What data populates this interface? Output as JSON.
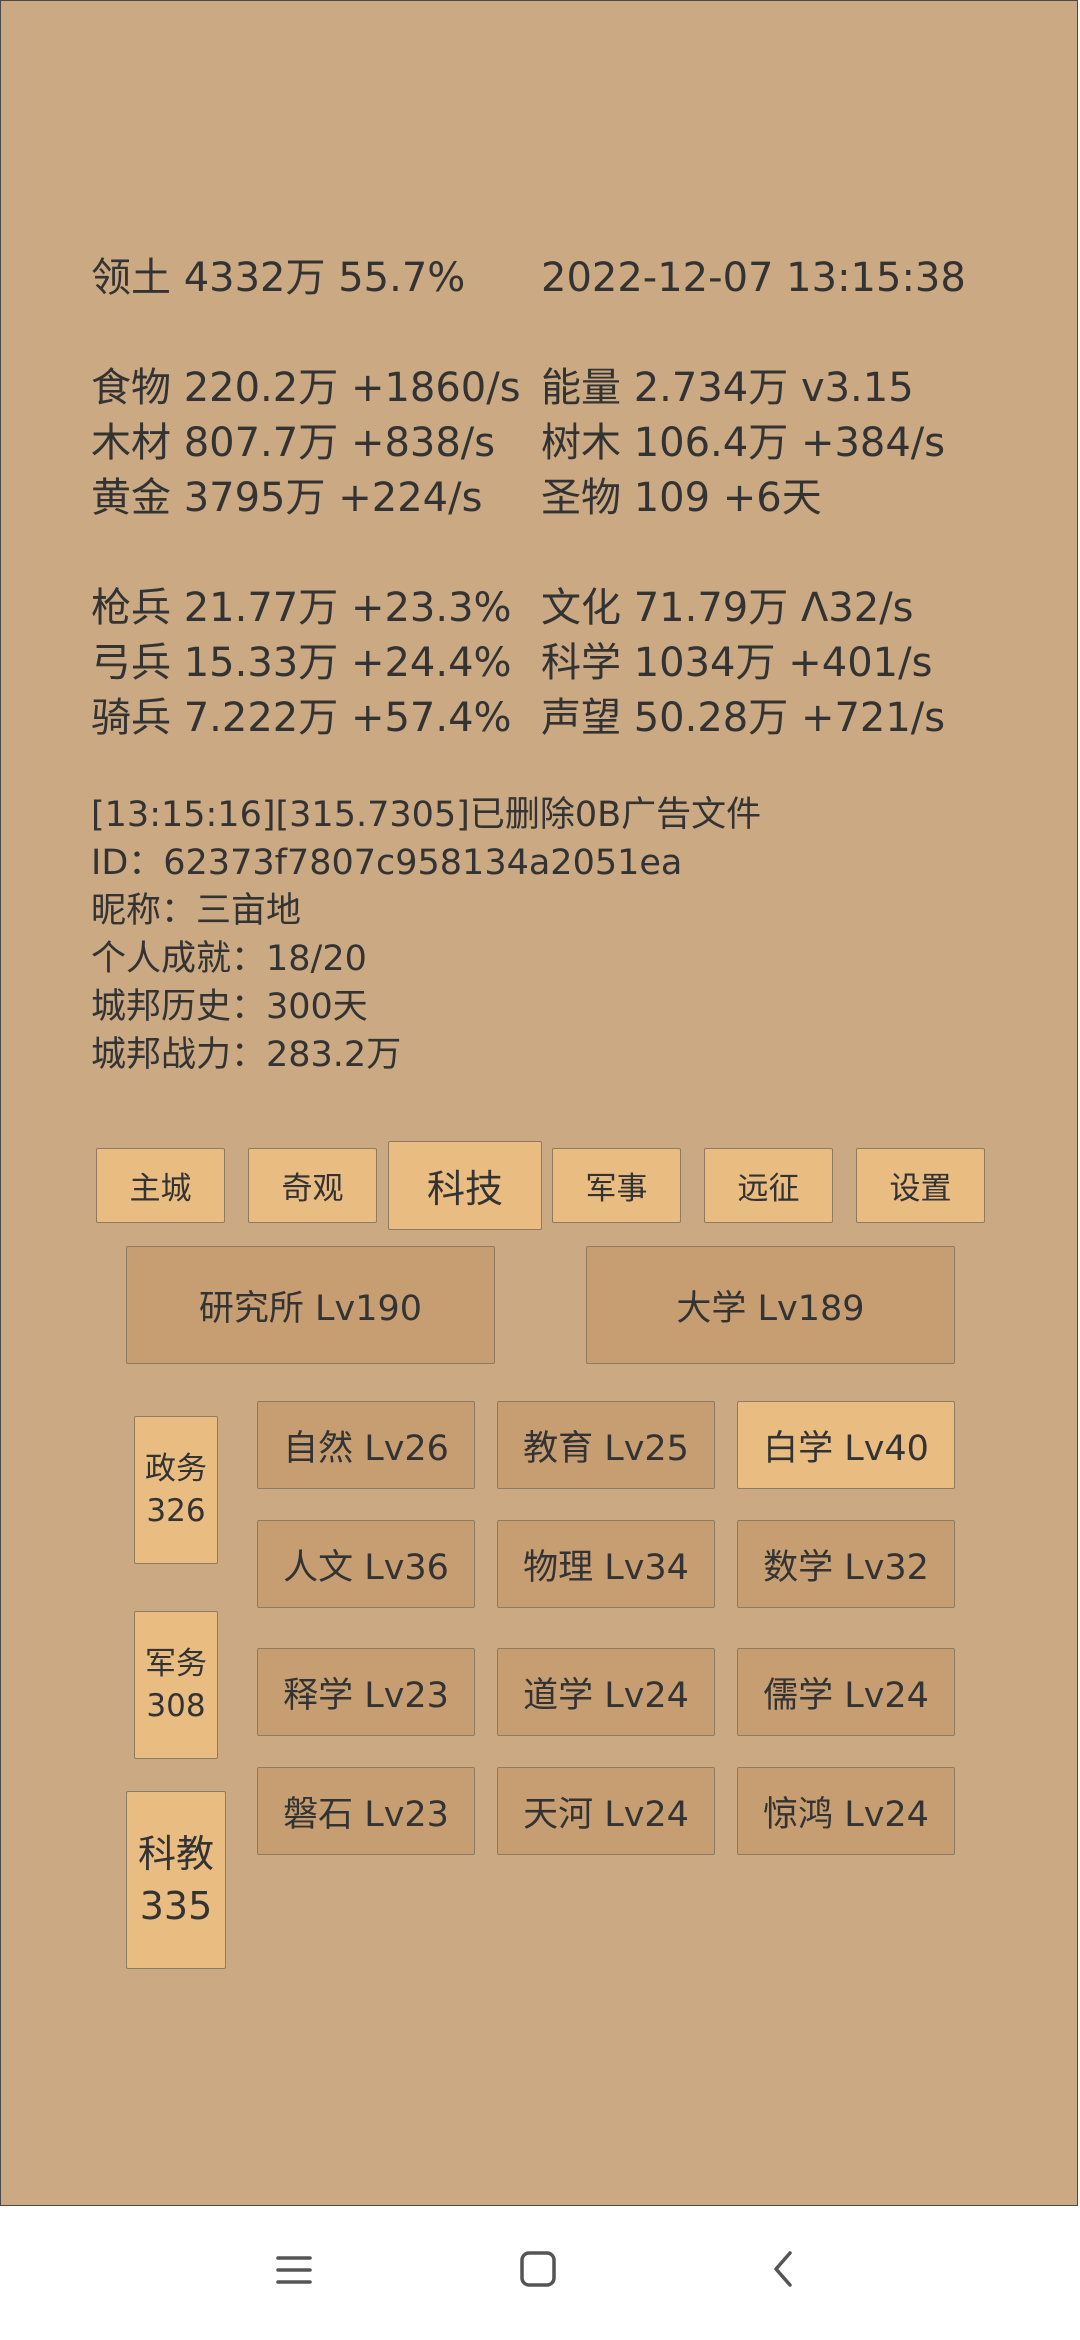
{
  "stats": {
    "territory": "领土  4332万  55.7%",
    "datetime": "2022-12-07 13:15:38",
    "food": "食物  220.2万 +1860/s",
    "energy": "能量  2.734万  v3.15",
    "wood": "木材  807.7万 +838/s",
    "tree": "树木  106.4万 +384/s",
    "gold": "黄金  3795万 +224/s",
    "relic": "圣物  109 +6天",
    "spearman": "枪兵  21.77万 +23.3%",
    "culture": "文化  71.79万 Λ32/s",
    "archer": "弓兵  15.33万 +24.4%",
    "science": "科学  1034万 +401/s",
    "cavalry": "骑兵  7.222万 +57.4%",
    "prestige": "声望  50.28万 +721/s"
  },
  "info": {
    "log": "[13:15:16][315.7305]已删除0B广告文件",
    "id": "ID：62373f7807c958134a2051ea",
    "nickname": "昵称：三亩地",
    "achievements": "个人成就：18/20",
    "history": "城邦历史：300天",
    "power": "城邦战力：283.2万"
  },
  "tabs": {
    "main_city": "主城",
    "wonders": "奇观",
    "tech": "科技",
    "military": "军事",
    "expedition": "远征",
    "settings": "设置"
  },
  "buildings": {
    "institute": "研究所 Lv190",
    "university": "大学 Lv189"
  },
  "categories": {
    "politics": "政务\n326",
    "military_affairs": "军务\n308",
    "science_edu": "科教\n335"
  },
  "techs": {
    "nature": "自然 Lv26",
    "education": "教育 Lv25",
    "self_study": "白学 Lv40",
    "humanities": "人文 Lv36",
    "physics": "物理 Lv34",
    "math": "数学 Lv32",
    "buddhism": "释学 Lv23",
    "taoism": "道学 Lv24",
    "confucianism": "儒学 Lv24",
    "boulder": "磐石 Lv23",
    "galaxy": "天河 Lv24",
    "startle": "惊鸿 Lv24"
  },
  "colors": {
    "background": "#caa983",
    "button_light": "#e9bc82",
    "button_dark": "#c79e72",
    "text": "#333333"
  },
  "nav_icons": [
    "menu-icon",
    "home-icon",
    "back-icon"
  ]
}
